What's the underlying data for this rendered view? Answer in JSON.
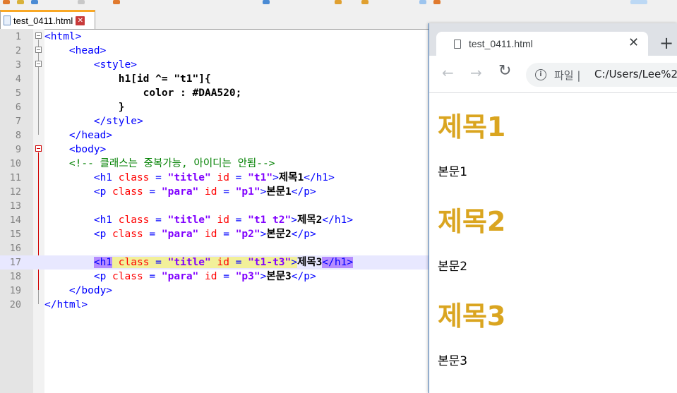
{
  "editor": {
    "tab_label": "test_0411.html",
    "tab_close_glyph": "✕",
    "lines": [
      {
        "n": "1",
        "segs": [
          {
            "t": "<html>",
            "c": "t-tag"
          }
        ]
      },
      {
        "n": "2",
        "segs": [
          {
            "t": "    <head>",
            "c": "t-tag"
          }
        ]
      },
      {
        "n": "3",
        "segs": [
          {
            "t": "        <style>",
            "c": "t-tag"
          }
        ]
      },
      {
        "n": "4",
        "segs": [
          {
            "t": "            h1[id ^= \"t1\"]{",
            "c": "t-css"
          }
        ]
      },
      {
        "n": "5",
        "segs": [
          {
            "t": "                color : #DAA520;",
            "c": "t-css"
          }
        ]
      },
      {
        "n": "6",
        "segs": [
          {
            "t": "            }",
            "c": "t-css"
          }
        ]
      },
      {
        "n": "7",
        "segs": [
          {
            "t": "        </style>",
            "c": "t-tag"
          }
        ]
      },
      {
        "n": "8",
        "segs": [
          {
            "t": "    </head>",
            "c": "t-tag"
          }
        ]
      },
      {
        "n": "9",
        "segs": [
          {
            "t": "    <body>",
            "c": "t-tag"
          }
        ]
      },
      {
        "n": "10",
        "segs": [
          {
            "t": "    <!-- 클래스는 중복가능, 아이디는 안됨-->",
            "c": "t-com"
          }
        ]
      },
      {
        "n": "11",
        "segs": [
          {
            "t": "        <h1",
            "c": "t-tag"
          },
          {
            "t": " class",
            "c": "t-attr"
          },
          {
            "t": " = ",
            "c": "t-tag"
          },
          {
            "t": "\"title\"",
            "c": "t-val"
          },
          {
            "t": " id",
            "c": "t-attr"
          },
          {
            "t": " = ",
            "c": "t-tag"
          },
          {
            "t": "\"t1\"",
            "c": "t-val"
          },
          {
            "t": ">",
            "c": "t-tag"
          },
          {
            "t": "제목1",
            "c": "t-txt"
          },
          {
            "t": "</h1>",
            "c": "t-tag"
          }
        ]
      },
      {
        "n": "12",
        "segs": [
          {
            "t": "        <p",
            "c": "t-tag"
          },
          {
            "t": " class",
            "c": "t-attr"
          },
          {
            "t": " = ",
            "c": "t-tag"
          },
          {
            "t": "\"para\"",
            "c": "t-val"
          },
          {
            "t": " id",
            "c": "t-attr"
          },
          {
            "t": " = ",
            "c": "t-tag"
          },
          {
            "t": "\"p1\"",
            "c": "t-val"
          },
          {
            "t": ">",
            "c": "t-tag"
          },
          {
            "t": "본문1",
            "c": "t-txt"
          },
          {
            "t": "</p>",
            "c": "t-tag"
          }
        ]
      },
      {
        "n": "13",
        "segs": []
      },
      {
        "n": "14",
        "segs": [
          {
            "t": "        <h1",
            "c": "t-tag"
          },
          {
            "t": " class",
            "c": "t-attr"
          },
          {
            "t": " = ",
            "c": "t-tag"
          },
          {
            "t": "\"title\"",
            "c": "t-val"
          },
          {
            "t": " id",
            "c": "t-attr"
          },
          {
            "t": " = ",
            "c": "t-tag"
          },
          {
            "t": "\"t1 t2\"",
            "c": "t-val"
          },
          {
            "t": ">",
            "c": "t-tag"
          },
          {
            "t": "제목2",
            "c": "t-txt"
          },
          {
            "t": "</h1>",
            "c": "t-tag"
          }
        ]
      },
      {
        "n": "15",
        "segs": [
          {
            "t": "        <p",
            "c": "t-tag"
          },
          {
            "t": " class",
            "c": "t-attr"
          },
          {
            "t": " = ",
            "c": "t-tag"
          },
          {
            "t": "\"para\"",
            "c": "t-val"
          },
          {
            "t": " id",
            "c": "t-attr"
          },
          {
            "t": " = ",
            "c": "t-tag"
          },
          {
            "t": "\"p2\"",
            "c": "t-val"
          },
          {
            "t": ">",
            "c": "t-tag"
          },
          {
            "t": "본문2",
            "c": "t-txt"
          },
          {
            "t": "</p>",
            "c": "t-tag"
          }
        ]
      },
      {
        "n": "16",
        "segs": []
      },
      {
        "n": "17",
        "current": true,
        "segs": [
          {
            "t": "        "
          },
          {
            "t": "<h1",
            "c": "t-tag hl-tag"
          },
          {
            "t": " class = \"title\" id = \"t1-t3\"",
            "c": "hl-attr",
            "inner": [
              {
                "t": " ",
                "c": "t-tag"
              },
              {
                "t": "class",
                "c": "t-attr"
              },
              {
                "t": " = ",
                "c": "t-tag"
              },
              {
                "t": "\"title\"",
                "c": "t-val"
              },
              {
                "t": " ",
                "c": "t-tag"
              },
              {
                "t": "id",
                "c": "t-attr"
              },
              {
                "t": " = ",
                "c": "t-tag"
              },
              {
                "t": "\"t1-t3\"",
                "c": "t-val"
              }
            ]
          },
          {
            "t": ">",
            "c": "t-tag hl-attr"
          },
          {
            "t": "제목3",
            "c": "t-txt"
          },
          {
            "t": "</h1>",
            "c": "t-tag hl-tag"
          }
        ]
      },
      {
        "n": "18",
        "segs": [
          {
            "t": "        <p",
            "c": "t-tag"
          },
          {
            "t": " class",
            "c": "t-attr"
          },
          {
            "t": " = ",
            "c": "t-tag"
          },
          {
            "t": "\"para\"",
            "c": "t-val"
          },
          {
            "t": " id",
            "c": "t-attr"
          },
          {
            "t": " = ",
            "c": "t-tag"
          },
          {
            "t": "\"p3\"",
            "c": "t-val"
          },
          {
            "t": ">",
            "c": "t-tag"
          },
          {
            "t": "본문3",
            "c": "t-txt"
          },
          {
            "t": "</p>",
            "c": "t-tag"
          }
        ]
      },
      {
        "n": "19",
        "segs": [
          {
            "t": "    </body>",
            "c": "t-tag"
          }
        ]
      },
      {
        "n": "20",
        "segs": [
          {
            "t": "</html>",
            "c": "t-tag"
          }
        ]
      }
    ]
  },
  "browser": {
    "tab_title": "test_0411.html",
    "tab_close_glyph": "✕",
    "new_tab_glyph": "+",
    "back_glyph": "←",
    "forward_glyph": "→",
    "reload_glyph": "↻",
    "info_glyph": "i",
    "scheme_label": "파일 |",
    "url": "C:/Users/Lee%2",
    "page": {
      "h1_color": "#DAA520",
      "headings": [
        "제목1",
        "제목2",
        "제목3"
      ],
      "paragraphs": [
        "본문1",
        "본문2",
        "본문3"
      ]
    }
  }
}
